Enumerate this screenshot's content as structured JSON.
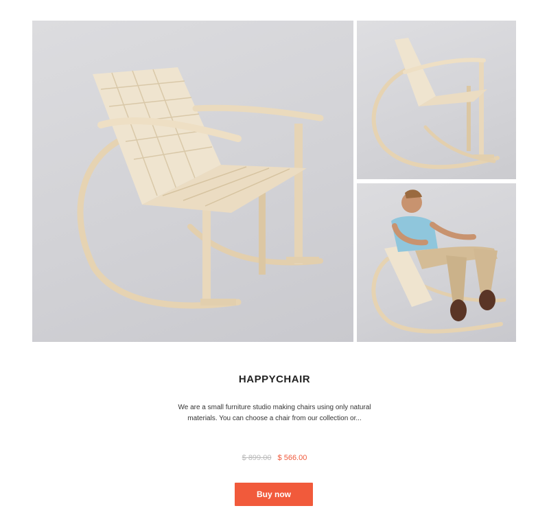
{
  "product": {
    "title": "HAPPYCHAIR",
    "description": "We are a small furniture studio making chairs using only natural materials. You can choose a chair from our collection or...",
    "price_old": "$ 899.00",
    "price_new": "$ 566.00",
    "buy_label": "Buy now"
  },
  "colors": {
    "accent": "#f15a3b",
    "price_new": "#f0593b",
    "price_old": "#b9b9b9",
    "photo_background": "#d6d6da",
    "wood": "#e8d6b8"
  },
  "gallery": {
    "photos": [
      {
        "subject": "rocking-chair-three-quarter-view"
      },
      {
        "subject": "rocking-chair-side-view"
      },
      {
        "subject": "man-sitting-in-rocking-chair"
      }
    ]
  }
}
